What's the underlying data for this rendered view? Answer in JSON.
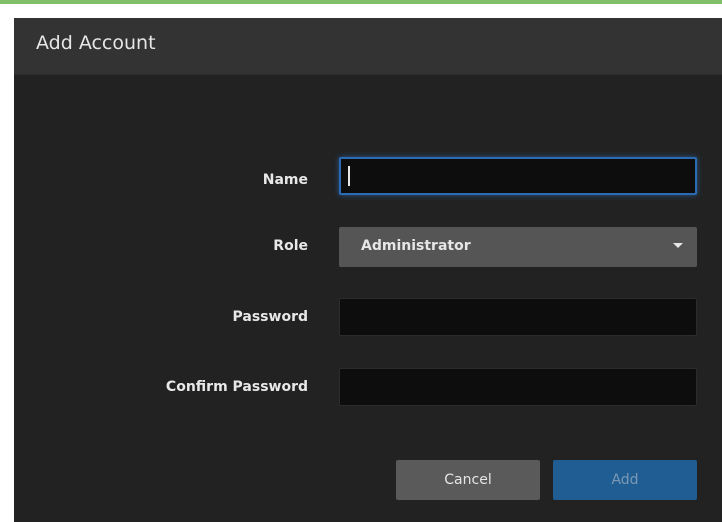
{
  "dialog": {
    "title": "Add Account"
  },
  "form": {
    "name": {
      "label": "Name",
      "value": ""
    },
    "role": {
      "label": "Role",
      "selected": "Administrator"
    },
    "password": {
      "label": "Password",
      "value": ""
    },
    "confirm_password": {
      "label": "Confirm Password",
      "value": ""
    }
  },
  "buttons": {
    "cancel_label": "Cancel",
    "add_label": "Add"
  },
  "icons": {
    "dropdown": "chevron-down-icon"
  },
  "colors": {
    "accent_top": "#7fbf6a",
    "dialog_bg": "#222222",
    "header_bg": "#333333",
    "focus_border": "#2a6bb3",
    "add_button_bg": "#1f5d93",
    "cancel_button_bg": "#5a5a5a",
    "select_bg": "#555555"
  }
}
